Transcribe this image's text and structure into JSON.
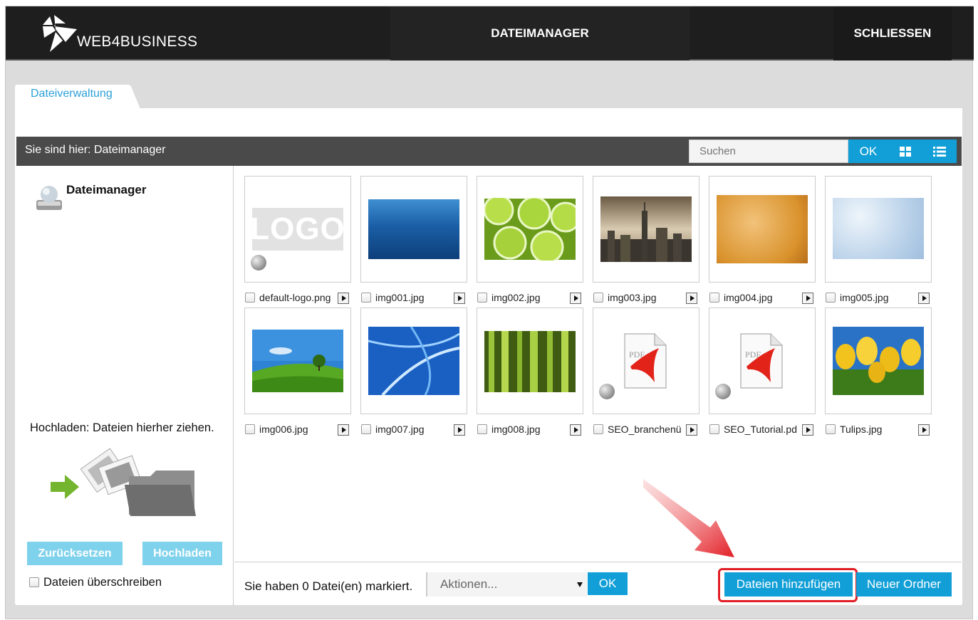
{
  "header": {
    "brand": "WEB4BUSINESS",
    "title": "DATEIMANAGER",
    "close": "SCHLIESSEN"
  },
  "tab": {
    "label": "Dateiverwaltung"
  },
  "breadcrumb": {
    "text": "Sie sind hier: Dateimanager",
    "search_placeholder": "Suchen",
    "ok": "OK",
    "icons": [
      "grid-view-icon",
      "list-view-icon"
    ]
  },
  "sidebar": {
    "root": "Dateimanager",
    "upload_hint": "Hochladen: Dateien hierher ziehen.",
    "reset": "Zurücksetzen",
    "upload": "Hochladen",
    "overwrite": "Dateien überschreiben"
  },
  "files": [
    {
      "name": "default-logo.png"
    },
    {
      "name": "img001.jpg"
    },
    {
      "name": "img002.jpg"
    },
    {
      "name": "img003.jpg"
    },
    {
      "name": "img004.jpg"
    },
    {
      "name": "img005.jpg"
    },
    {
      "name": "img006.jpg"
    },
    {
      "name": "img007.jpg"
    },
    {
      "name": "img008.jpg"
    },
    {
      "name": "SEO_branchenü"
    },
    {
      "name": "SEO_Tutorial.pd"
    },
    {
      "name": "Tulips.jpg"
    }
  ],
  "thumbnails": {
    "logo_text": "LOGO",
    "pdf_label": "PDF"
  },
  "footer": {
    "selection": "Sie haben 0 Datei(en) markiert.",
    "actions": "Aktionen...",
    "ok": "OK",
    "add_files": "Dateien hinzufügen",
    "new_folder": "Neuer Ordner"
  },
  "colors": {
    "accent": "#129fd7",
    "highlight": "#e21e26"
  }
}
